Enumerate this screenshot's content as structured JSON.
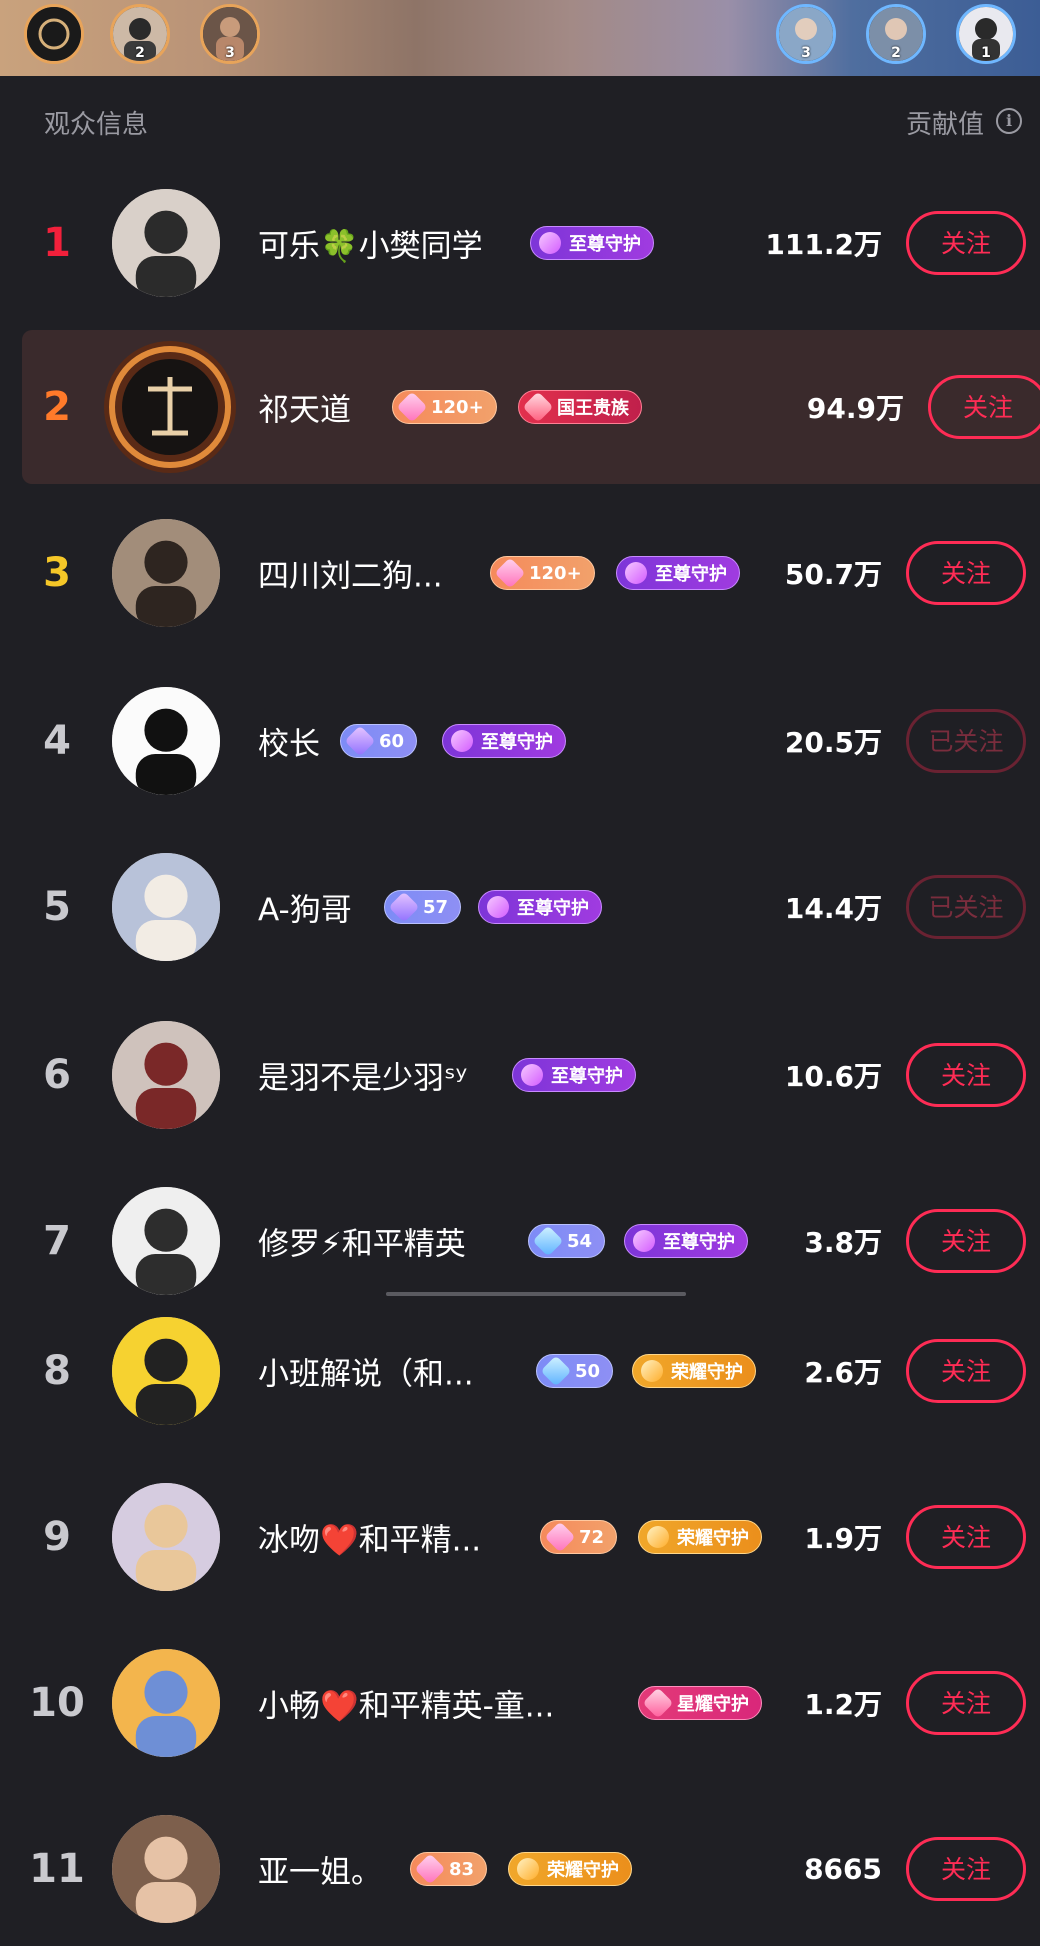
{
  "top_strip": {
    "left_avatars": [
      {
        "rank_badge": ""
      },
      {
        "rank_badge": "2"
      },
      {
        "rank_badge": "3"
      }
    ],
    "right_avatars": [
      {
        "rank_badge": "3"
      },
      {
        "rank_badge": "2"
      },
      {
        "rank_badge": "1"
      }
    ]
  },
  "header": {
    "left_label": "观众信息",
    "right_label": "贡献值",
    "info_glyph": "i"
  },
  "colors": {
    "rank1": "#f2203b",
    "rank2": "#ff7a2a",
    "rank3": "#f5c728",
    "accent_follow": "#fe2c55"
  },
  "rows": [
    {
      "rank": "1",
      "name": "可乐🍀小樊同学",
      "badges": [
        {
          "type": "zz",
          "text": "至尊守护"
        }
      ],
      "value": "111.2万",
      "follow": "关注",
      "followed": false
    },
    {
      "rank": "2",
      "name": "祁天道",
      "badges": [
        {
          "type": "lv-orange",
          "text": "120+"
        },
        {
          "type": "gw",
          "text": "国王贵族"
        }
      ],
      "value": "94.9万",
      "follow": "关注",
      "followed": false,
      "highlight": true
    },
    {
      "rank": "3",
      "name": "四川刘二狗...",
      "badges": [
        {
          "type": "lv-orange",
          "text": "120+"
        },
        {
          "type": "zz",
          "text": "至尊守护"
        }
      ],
      "value": "50.7万",
      "follow": "关注",
      "followed": false
    },
    {
      "rank": "4",
      "name": "校长",
      "badges": [
        {
          "type": "lv",
          "text": "60"
        },
        {
          "type": "zz",
          "text": "至尊守护"
        }
      ],
      "value": "20.5万",
      "follow": "已关注",
      "followed": true
    },
    {
      "rank": "5",
      "name": "A-狗哥",
      "badges": [
        {
          "type": "lv",
          "text": "57"
        },
        {
          "type": "zz",
          "text": "至尊守护"
        }
      ],
      "value": "14.4万",
      "follow": "已关注",
      "followed": true
    },
    {
      "rank": "6",
      "name": "是羽不是少羽ˢʸ",
      "badges": [
        {
          "type": "zz",
          "text": "至尊守护"
        }
      ],
      "value": "10.6万",
      "follow": "关注",
      "followed": false
    },
    {
      "rank": "7",
      "name": "修罗⚡和平精英",
      "badges": [
        {
          "type": "lv-blue",
          "text": "54"
        },
        {
          "type": "zz",
          "text": "至尊守护"
        }
      ],
      "value": "3.8万",
      "follow": "关注",
      "followed": false
    },
    {
      "rank": "8",
      "name": "小班解说（和...",
      "badges": [
        {
          "type": "lv-blue",
          "text": "50"
        },
        {
          "type": "ry",
          "text": "荣耀守护"
        }
      ],
      "value": "2.6万",
      "follow": "关注",
      "followed": false
    },
    {
      "rank": "9",
      "name": "冰吻❤️和平精...",
      "badges": [
        {
          "type": "lv-orange",
          "text": "72"
        },
        {
          "type": "ry",
          "text": "荣耀守护"
        }
      ],
      "value": "1.9万",
      "follow": "关注",
      "followed": false
    },
    {
      "rank": "10",
      "name": "小畅❤️和平精英-童...",
      "badges": [
        {
          "type": "xy",
          "text": "星耀守护"
        }
      ],
      "value": "1.2万",
      "follow": "关注",
      "followed": false
    },
    {
      "rank": "11",
      "name": "亚一姐。",
      "badges": [
        {
          "type": "lv-orange",
          "text": "83"
        },
        {
          "type": "ry",
          "text": "荣耀守护"
        }
      ],
      "value": "8665",
      "follow": "关注",
      "followed": false
    }
  ]
}
